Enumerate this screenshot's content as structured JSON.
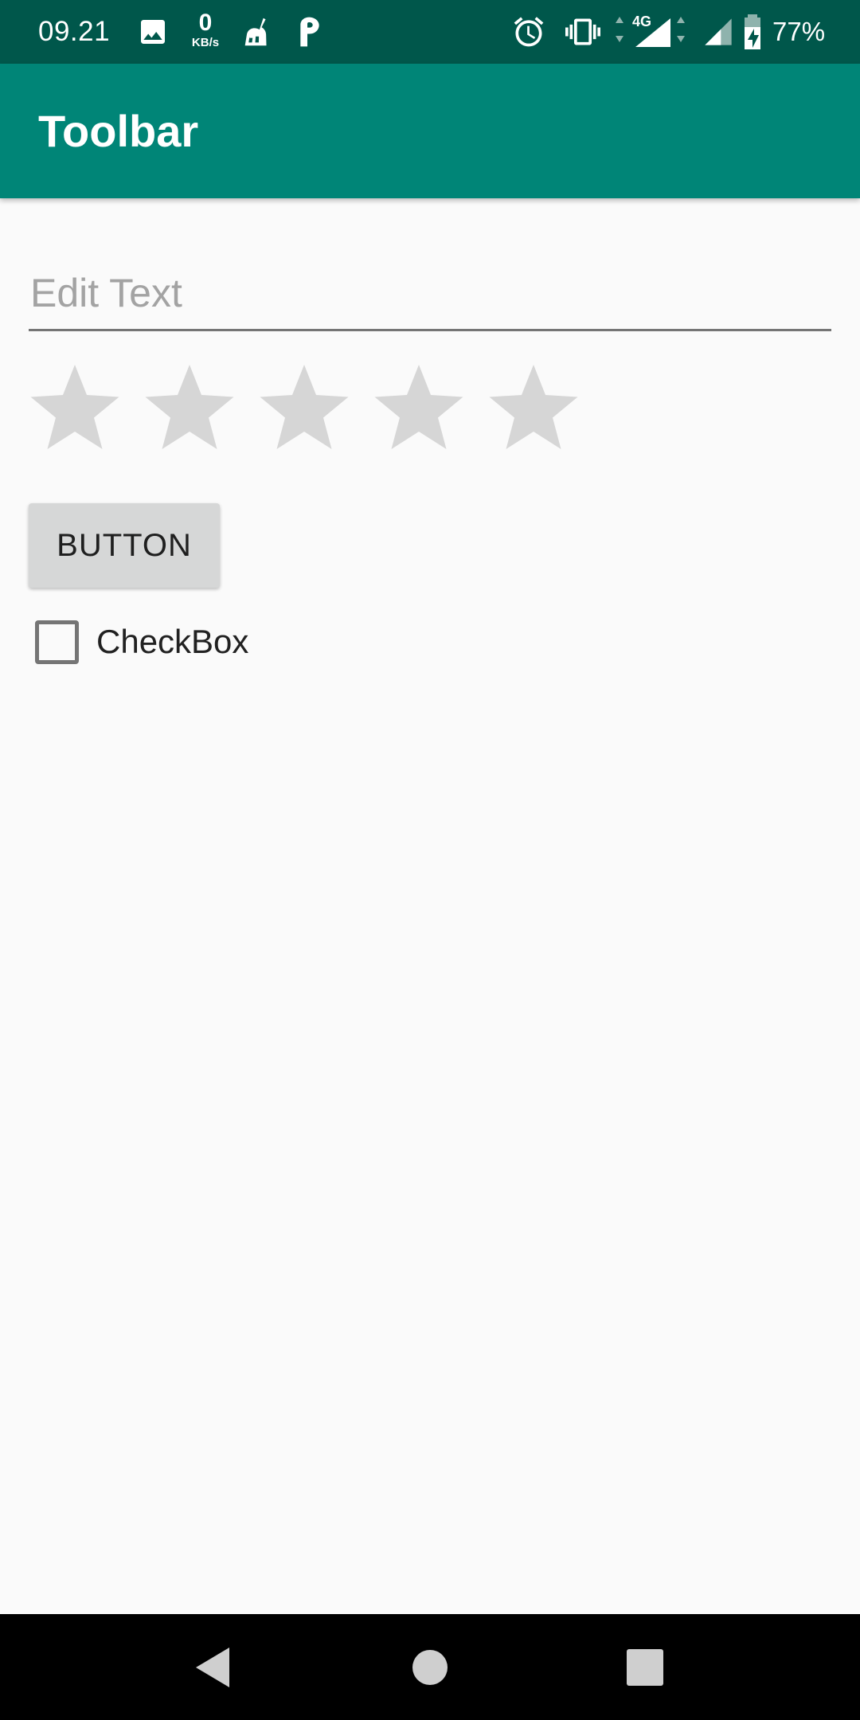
{
  "status_bar": {
    "time": "09.21",
    "net_speed_value": "0",
    "net_speed_unit": "KB/s",
    "network_type": "4G",
    "battery_percent": "77%",
    "icons": [
      "image-icon",
      "cleaner-icon",
      "p-app-icon",
      "alarm-icon",
      "vibrate-icon",
      "signal-4g-icon",
      "signal-icon",
      "battery-charging-icon"
    ]
  },
  "toolbar": {
    "title": "Toolbar"
  },
  "edit_text": {
    "placeholder": "Edit Text",
    "value": ""
  },
  "rating_bar": {
    "rating": 0,
    "max": 5,
    "star_color": "#d6d6d6"
  },
  "button": {
    "label": "BUTTON"
  },
  "checkbox": {
    "label": "CheckBox",
    "checked": false
  },
  "nav_bar": {
    "icons": [
      "back-icon",
      "home-icon",
      "recents-icon"
    ]
  },
  "colors": {
    "status_bar": "#00574b",
    "toolbar": "#008577",
    "background": "#fafafa"
  }
}
